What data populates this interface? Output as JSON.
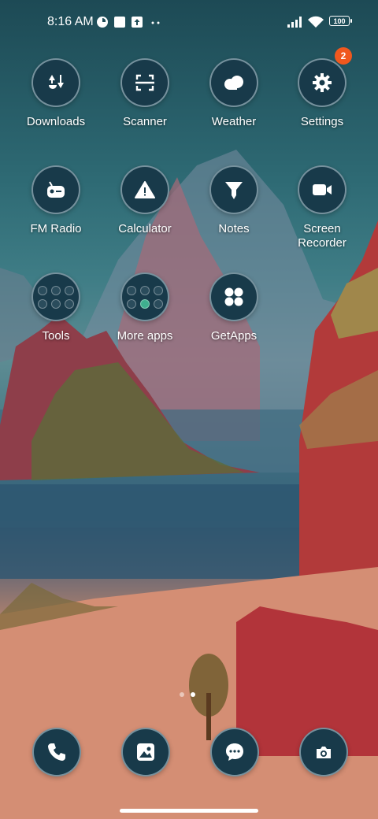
{
  "status_bar": {
    "time": "8:16 AM",
    "battery": "100"
  },
  "apps": [
    {
      "label": "Downloads",
      "icon": "downloads-icon"
    },
    {
      "label": "Scanner",
      "icon": "scanner-icon"
    },
    {
      "label": "Weather",
      "icon": "weather-icon"
    },
    {
      "label": "Settings",
      "icon": "gear-icon",
      "badge": "2"
    },
    {
      "label": "FM Radio",
      "icon": "radio-icon"
    },
    {
      "label": "Calculator",
      "icon": "calculator-icon"
    },
    {
      "label": "Notes",
      "icon": "notes-icon"
    },
    {
      "label": "Screen\nRecorder",
      "icon": "video-camera-icon"
    },
    {
      "label": "Tools",
      "icon": "folder-icon"
    },
    {
      "label": "More apps",
      "icon": "folder-icon"
    },
    {
      "label": "GetApps",
      "icon": "getapps-icon"
    }
  ],
  "dock": [
    {
      "name": "phone",
      "icon": "phone-icon"
    },
    {
      "name": "gallery",
      "icon": "gallery-icon"
    },
    {
      "name": "messages",
      "icon": "chat-icon"
    },
    {
      "name": "camera",
      "icon": "camera-icon"
    }
  ],
  "page_indicator": {
    "pages": 2,
    "current": 2
  },
  "colors": {
    "icon_bg": "#183a4a",
    "badge": "#f0581e"
  }
}
